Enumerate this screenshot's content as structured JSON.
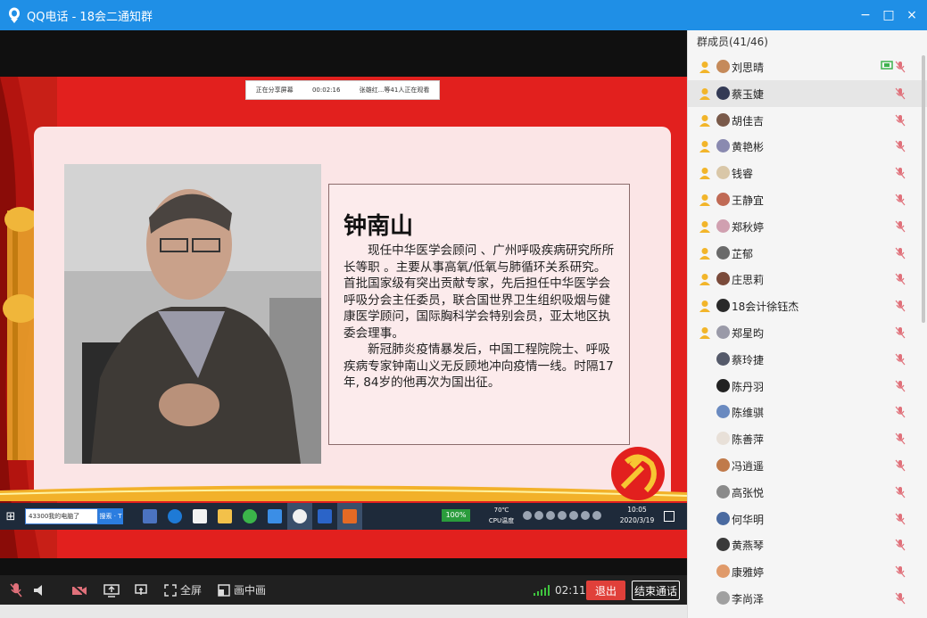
{
  "window": {
    "title": "QQ电话 - 18会二通知群",
    "buttons": [
      "−",
      "□",
      "×"
    ]
  },
  "share_banner": {
    "status": "正在分享屏幕",
    "elapsed": "00:02:16",
    "viewers": "张雄红...等41人正在观看"
  },
  "slide": {
    "name": "钟南山",
    "para1": "现任中华医学会顾问 、广州呼吸疾病研究所所长等职 。主要从事高氧/低氧与肺循环关系研究。首批国家级有突出贡献专家，先后担任中华医学会呼吸分会主任委员，联合国世界卫生组织吸烟与健康医学顾问，国际胸科学会特别会员，亚太地区执委会理事。",
    "para2": "新冠肺炎疫情暴发后，中国工程院院士、呼吸疾病专家钟南山义无反顾地冲向疫情一线。时隔17年, 84岁的他再次为国出征。"
  },
  "taskbar": {
    "search_text": "43300我的电脑了",
    "search_button": "搜索 · T",
    "battery": "100%",
    "temp": "70℃",
    "cpu": "CPU温度",
    "time": "10:05",
    "date": "2020/3/19"
  },
  "toolbar": {
    "fullscreen": "全屏",
    "pip": "画中画",
    "timer": "02:11",
    "quit": "退出",
    "end_call": "结束通话"
  },
  "members": {
    "header": "群成员(41/46)",
    "list": [
      {
        "name": "刘思晴",
        "host": true,
        "screen": true,
        "avatar": "#c58a5a"
      },
      {
        "name": "蔡玉婕",
        "host": true,
        "screen": false,
        "avatar": "#333a55",
        "selected": true
      },
      {
        "name": "胡佳吉",
        "host": true,
        "screen": false,
        "avatar": "#7a5a4a"
      },
      {
        "name": "黄艳彬",
        "host": true,
        "screen": false,
        "avatar": "#8a8ab0"
      },
      {
        "name": "钱睿",
        "host": true,
        "screen": false,
        "avatar": "#d9c7a8"
      },
      {
        "name": "王静宜",
        "host": true,
        "screen": false,
        "avatar": "#c06a55"
      },
      {
        "name": "郑秋婷",
        "host": true,
        "screen": false,
        "avatar": "#d0a0b0"
      },
      {
        "name": "芷郁",
        "host": true,
        "screen": false,
        "avatar": "#6a6a6a"
      },
      {
        "name": "庄思莉",
        "host": true,
        "screen": false,
        "avatar": "#7a4a3a"
      },
      {
        "name": "18会计徐钰杰",
        "host": true,
        "screen": false,
        "avatar": "#2a2a2a"
      },
      {
        "name": "郑星昀",
        "host": true,
        "screen": false,
        "avatar": "#9a9aa8"
      },
      {
        "name": "蔡玲捷",
        "host": false,
        "screen": false,
        "avatar": "#555a6a"
      },
      {
        "name": "陈丹羽",
        "host": false,
        "screen": false,
        "avatar": "#222222"
      },
      {
        "name": "陈维骐",
        "host": false,
        "screen": false,
        "avatar": "#6a8ac0"
      },
      {
        "name": "陈善萍",
        "host": false,
        "screen": false,
        "avatar": "#e8e0d8"
      },
      {
        "name": "冯逍遥",
        "host": false,
        "screen": false,
        "avatar": "#c07a4a"
      },
      {
        "name": "高张悦",
        "host": false,
        "screen": false,
        "avatar": "#8a8a8a"
      },
      {
        "name": "何华明",
        "host": false,
        "screen": false,
        "avatar": "#4a6aa0"
      },
      {
        "name": "黄燕琴",
        "host": false,
        "screen": false,
        "avatar": "#3a3a3a"
      },
      {
        "name": "康雅婷",
        "host": false,
        "screen": false,
        "avatar": "#e09a6a"
      },
      {
        "name": "李尚泽",
        "host": false,
        "screen": false,
        "avatar": "#a0a0a0"
      }
    ]
  },
  "colors": {
    "titlebar": "#1f8fe6",
    "slide_red": "#e2201e",
    "quit_red": "#e0403a",
    "host_icon": "#f2b52a",
    "mic_muted": "#e0707a"
  }
}
